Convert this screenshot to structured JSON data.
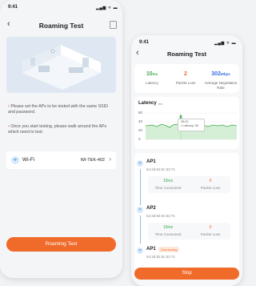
{
  "left_screen": {
    "time": "9:41",
    "signal": "▂▄▆ ᯤ ▬",
    "title": "Roaming Test",
    "tips": [
      "Please set the APs to be tested with the same SSID and password.",
      "Once you start testing, please walk around the APs which need to test."
    ],
    "wifi_label": "Wi-Fi",
    "wifi_value": "WI-TEK-402",
    "button": "Roaming Test"
  },
  "right_screen": {
    "time": "9:41",
    "signal": "▂▄▆ ᯤ ▬",
    "title": "Roaming Test",
    "stats": [
      {
        "value": "10",
        "unit": "ms",
        "label": "Latency",
        "color": "#3aa84a"
      },
      {
        "value": "2",
        "unit": "",
        "label": "Packet Loss",
        "color": "#f06a2a"
      },
      {
        "value": "302",
        "unit": "Mbps",
        "label": "Average Negotiation Rate",
        "color": "#3a6ee6"
      }
    ],
    "latency_title": "Latency",
    "latency_unit": "ms",
    "chart_yticks": [
      "60",
      "40",
      "20",
      "0"
    ],
    "tooltip_time": "09:22",
    "tooltip_value": "• Latency: 50",
    "aps": [
      {
        "name": "AP1",
        "mac": "54:3d:92:0c:52:71",
        "time": "10ms",
        "loss": "0",
        "time_label": "Time Consumed",
        "loss_label": "Packet Loss",
        "badge": ""
      },
      {
        "name": "AP2",
        "mac": "54:3d:92:0c:52:71",
        "time": "10ms",
        "loss": "0",
        "time_label": "Time Consumed",
        "loss_label": "Packet Loss",
        "badge": ""
      },
      {
        "name": "AP1",
        "mac": "54:3d:92:0c:52:71",
        "badge": "Connecting"
      }
    ],
    "button": "Stop"
  }
}
